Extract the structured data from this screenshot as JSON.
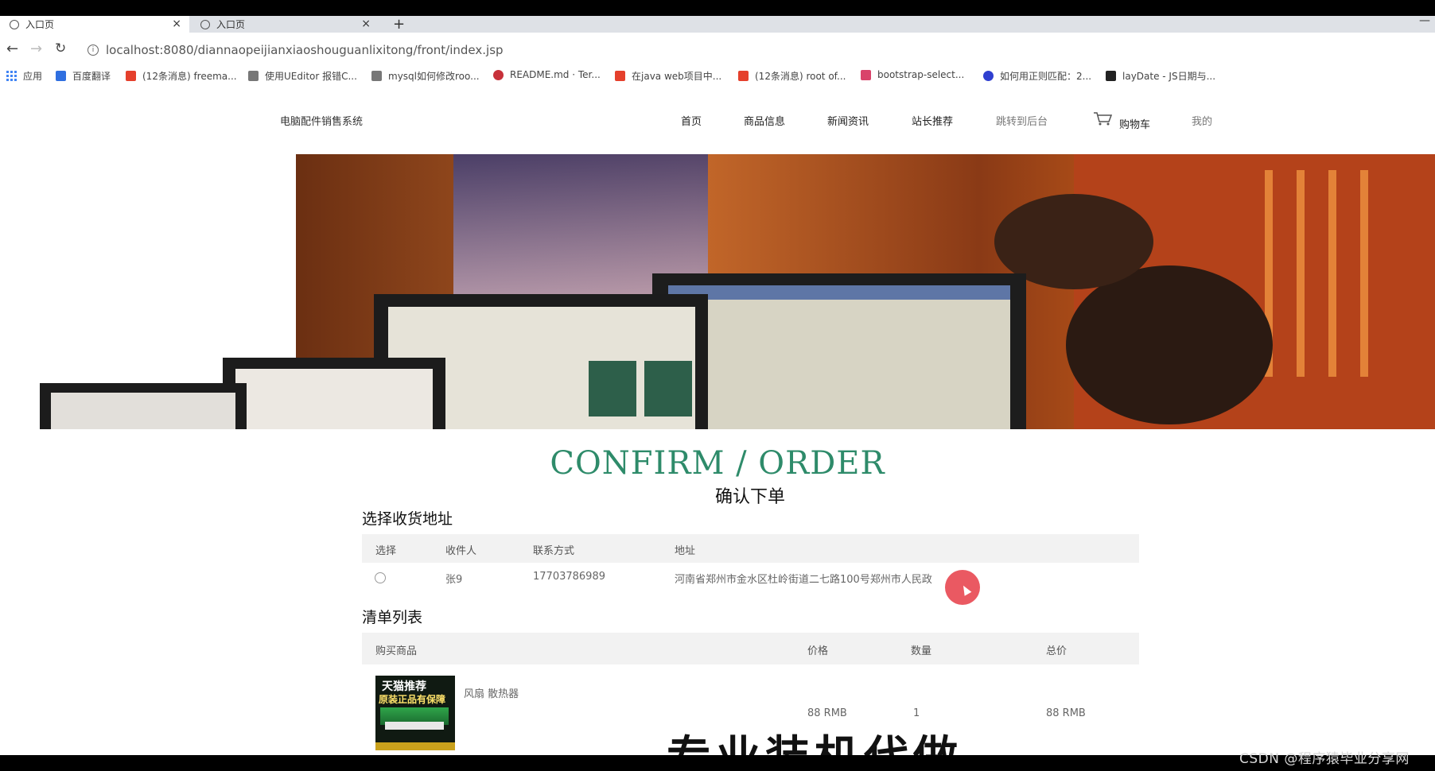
{
  "browser": {
    "tabs": [
      {
        "title": "入口页"
      },
      {
        "title": "入口页"
      }
    ],
    "new_tab_label": "+",
    "url": "localhost:8080/diannaopeijianxiaoshouguanlixitong/front/index.jsp",
    "bookmarks": [
      {
        "label": "应用",
        "color": "#4285f4"
      },
      {
        "label": "百度翻译",
        "color": "#2f6fe0"
      },
      {
        "label": "(12条消息) freema...",
        "color": "#e5402c"
      },
      {
        "label": "使用UEditor 报错C...",
        "color": "#555555"
      },
      {
        "label": "mysql如何修改roo...",
        "color": "#555555"
      },
      {
        "label": "README.md · Ter...",
        "color": "#c7313a"
      },
      {
        "label": "在java web项目中...",
        "color": "#e5402c"
      },
      {
        "label": "(12条消息) root of...",
        "color": "#e5402c"
      },
      {
        "label": "bootstrap-select...",
        "color": "#d9436a"
      },
      {
        "label": "如何用正则匹配：2...",
        "color": "#2f3fd0"
      },
      {
        "label": "layDate - JS日期与...",
        "color": "#222222"
      }
    ]
  },
  "site": {
    "title": "电脑配件销售系统",
    "nav": [
      "首页",
      "商品信息",
      "新闻资讯",
      "站长推荐",
      "跳转到后台",
      "购物车",
      "我的"
    ]
  },
  "confirm": {
    "title_en": "CONFIRM / ORDER",
    "title_cn": "确认下单"
  },
  "address_section": {
    "title": "选择收货地址",
    "headers": [
      "选择",
      "收件人",
      "联系方式",
      "地址"
    ],
    "rows": [
      {
        "name": "张9",
        "phone": "17703786989",
        "address": "河南省郑州市金水区杜岭街道二七路100号郑州市人民政"
      }
    ]
  },
  "order_section": {
    "title": "清单列表",
    "headers": [
      "购买商品",
      "价格",
      "数量",
      "总价"
    ],
    "items": [
      {
        "name": "风扇 散热器",
        "image_text_1": "天猫推荐",
        "image_text_2": "原装正品有保障",
        "price": "88 RMB",
        "quantity": "1",
        "total": "88 RMB"
      }
    ]
  },
  "partial_text": "专业装机代做",
  "watermark": "CSDN @程序猿毕业分享网",
  "colors": {
    "accent_green": "#2e8b6a",
    "cursor_highlight": "#e63c46"
  }
}
